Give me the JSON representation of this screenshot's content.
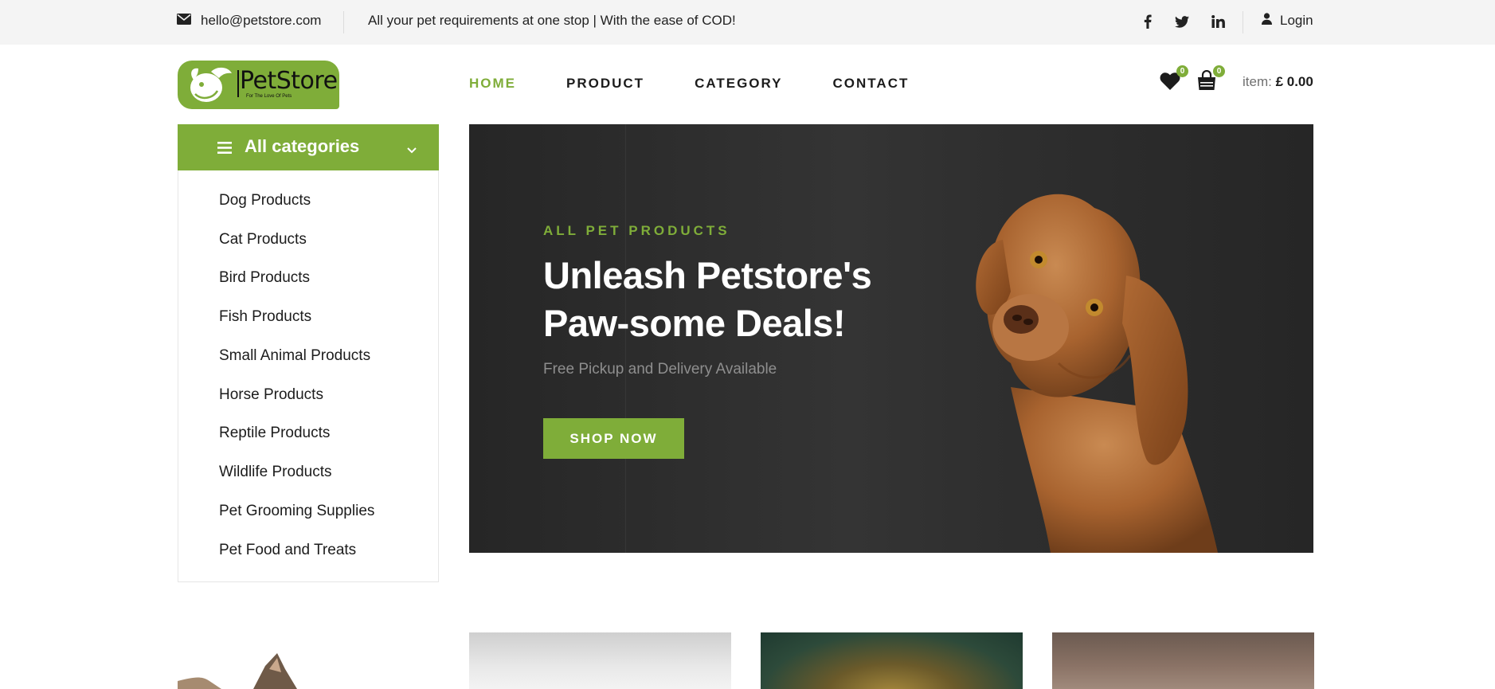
{
  "topbar": {
    "email": "hello@petstore.com",
    "tagline": "All your pet requirements at one stop | With the ease of COD!",
    "social": [
      "facebook-icon",
      "twitter-icon",
      "linkedin-icon"
    ],
    "login_label": "Login"
  },
  "logo": {
    "name": "PetStore",
    "tagline": "For The Love Of Pets"
  },
  "nav": {
    "items": [
      "HOME",
      "PRODUCT",
      "CATEGORY",
      "CONTACT"
    ],
    "active": "HOME"
  },
  "header": {
    "wishlist_count": "0",
    "cart_count": "0",
    "item_label": "item:",
    "item_total": "£ 0.00"
  },
  "categories": {
    "title": "All categories",
    "items": [
      "Dog Products",
      "Cat Products",
      "Bird Products",
      "Fish Products",
      "Small Animal Products",
      "Horse Products",
      "Reptile Products",
      "Wildlife Products",
      "Pet Grooming Supplies",
      "Pet Food and Treats"
    ]
  },
  "hero": {
    "kicker": "ALL PET PRODUCTS",
    "title_line1": "Unleash Petstore's",
    "title_line2": "Paw-some Deals!",
    "subtitle": "Free Pickup and Delivery Available",
    "button": "SHOP NOW"
  },
  "colors": {
    "accent": "#7fad39",
    "topbar_bg": "#f4f4f4",
    "hero_bg": "#2c2c2c",
    "text": "#1c1c1c"
  }
}
